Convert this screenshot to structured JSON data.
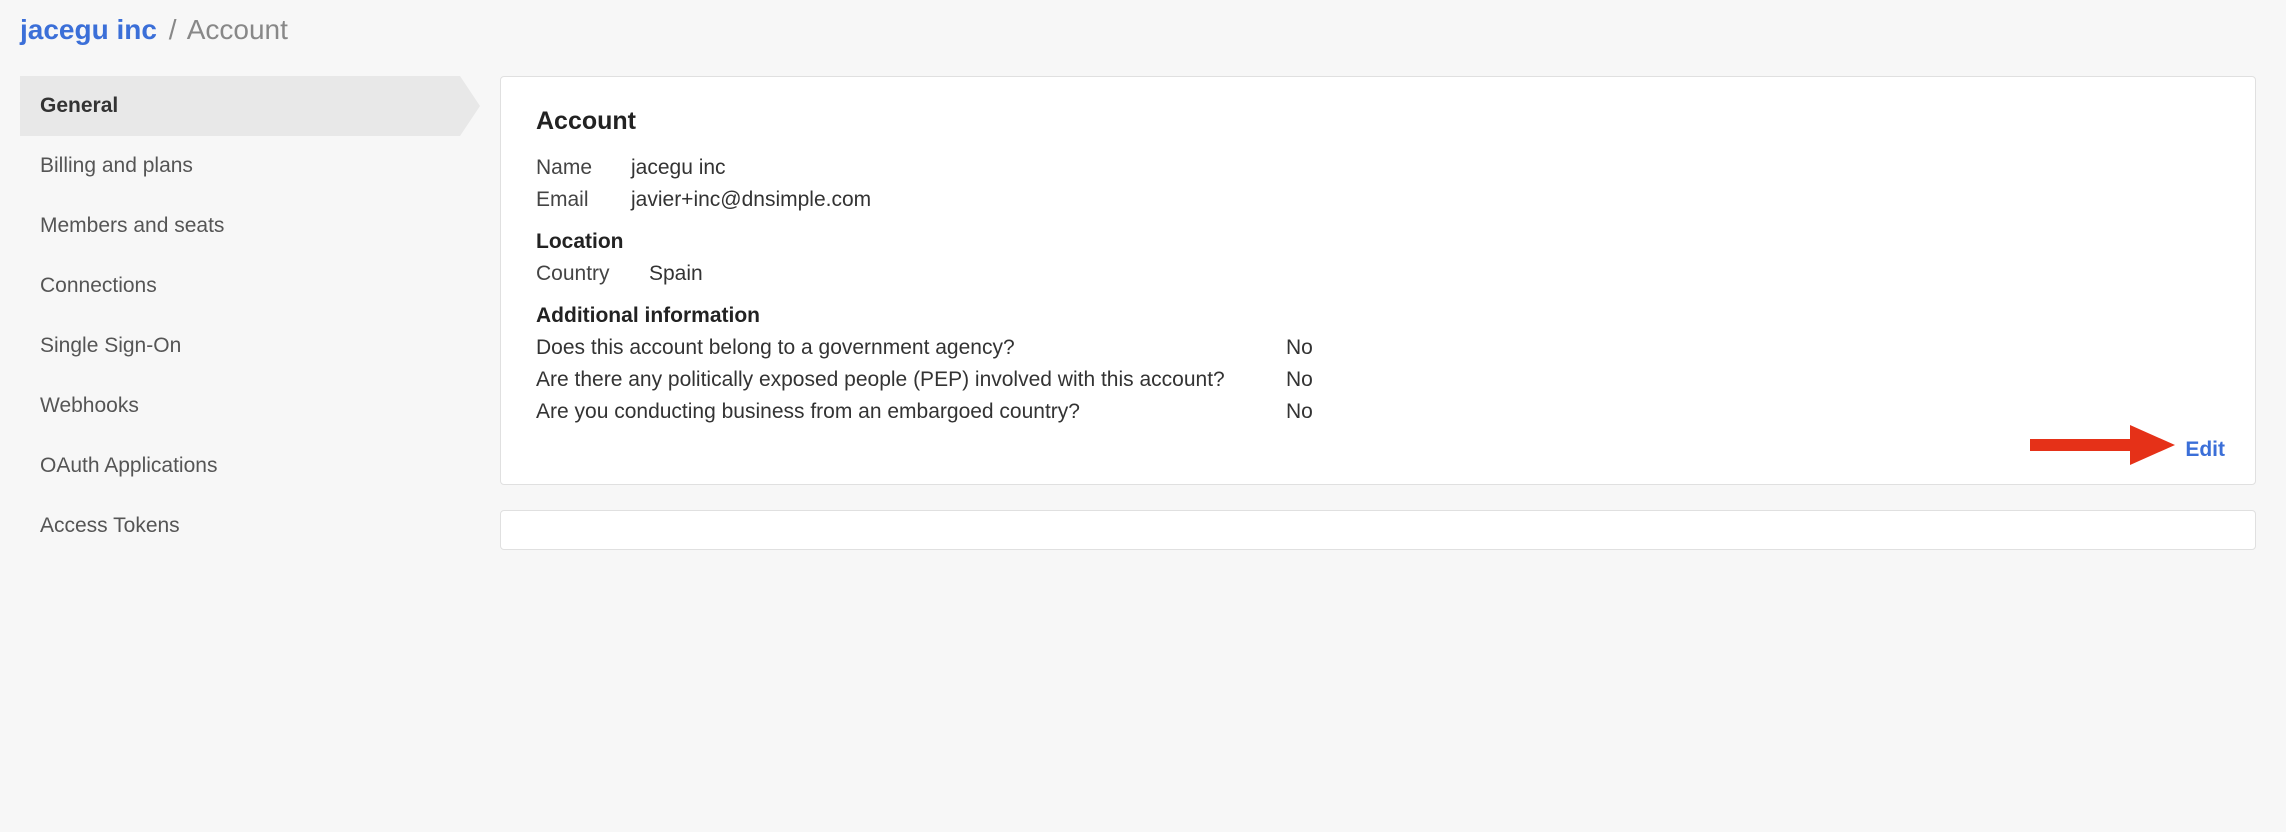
{
  "breadcrumb": {
    "org": "jacegu inc",
    "sep": "/",
    "current": "Account"
  },
  "sidebar": {
    "items": [
      {
        "label": "General",
        "active": true
      },
      {
        "label": "Billing and plans",
        "active": false
      },
      {
        "label": "Members and seats",
        "active": false
      },
      {
        "label": "Connections",
        "active": false
      },
      {
        "label": "Single Sign-On",
        "active": false
      },
      {
        "label": "Webhooks",
        "active": false
      },
      {
        "label": "OAuth Applications",
        "active": false
      },
      {
        "label": "Access Tokens",
        "active": false
      }
    ]
  },
  "account": {
    "title": "Account",
    "name_label": "Name",
    "name_value": "jacegu inc",
    "email_label": "Email",
    "email_value": "javier+inc@dnsimple.com",
    "location_heading": "Location",
    "country_label": "Country",
    "country_value": "Spain",
    "additional_heading": "Additional information",
    "questions": [
      {
        "q": "Does this account belong to a government agency?",
        "a": "No"
      },
      {
        "q": "Are there any politically exposed people (PEP) involved with this account?",
        "a": "No"
      },
      {
        "q": "Are you conducting business from an embargoed country?",
        "a": "No"
      }
    ],
    "edit_label": "Edit"
  },
  "annotation": {
    "arrow_color": "#e53118"
  }
}
